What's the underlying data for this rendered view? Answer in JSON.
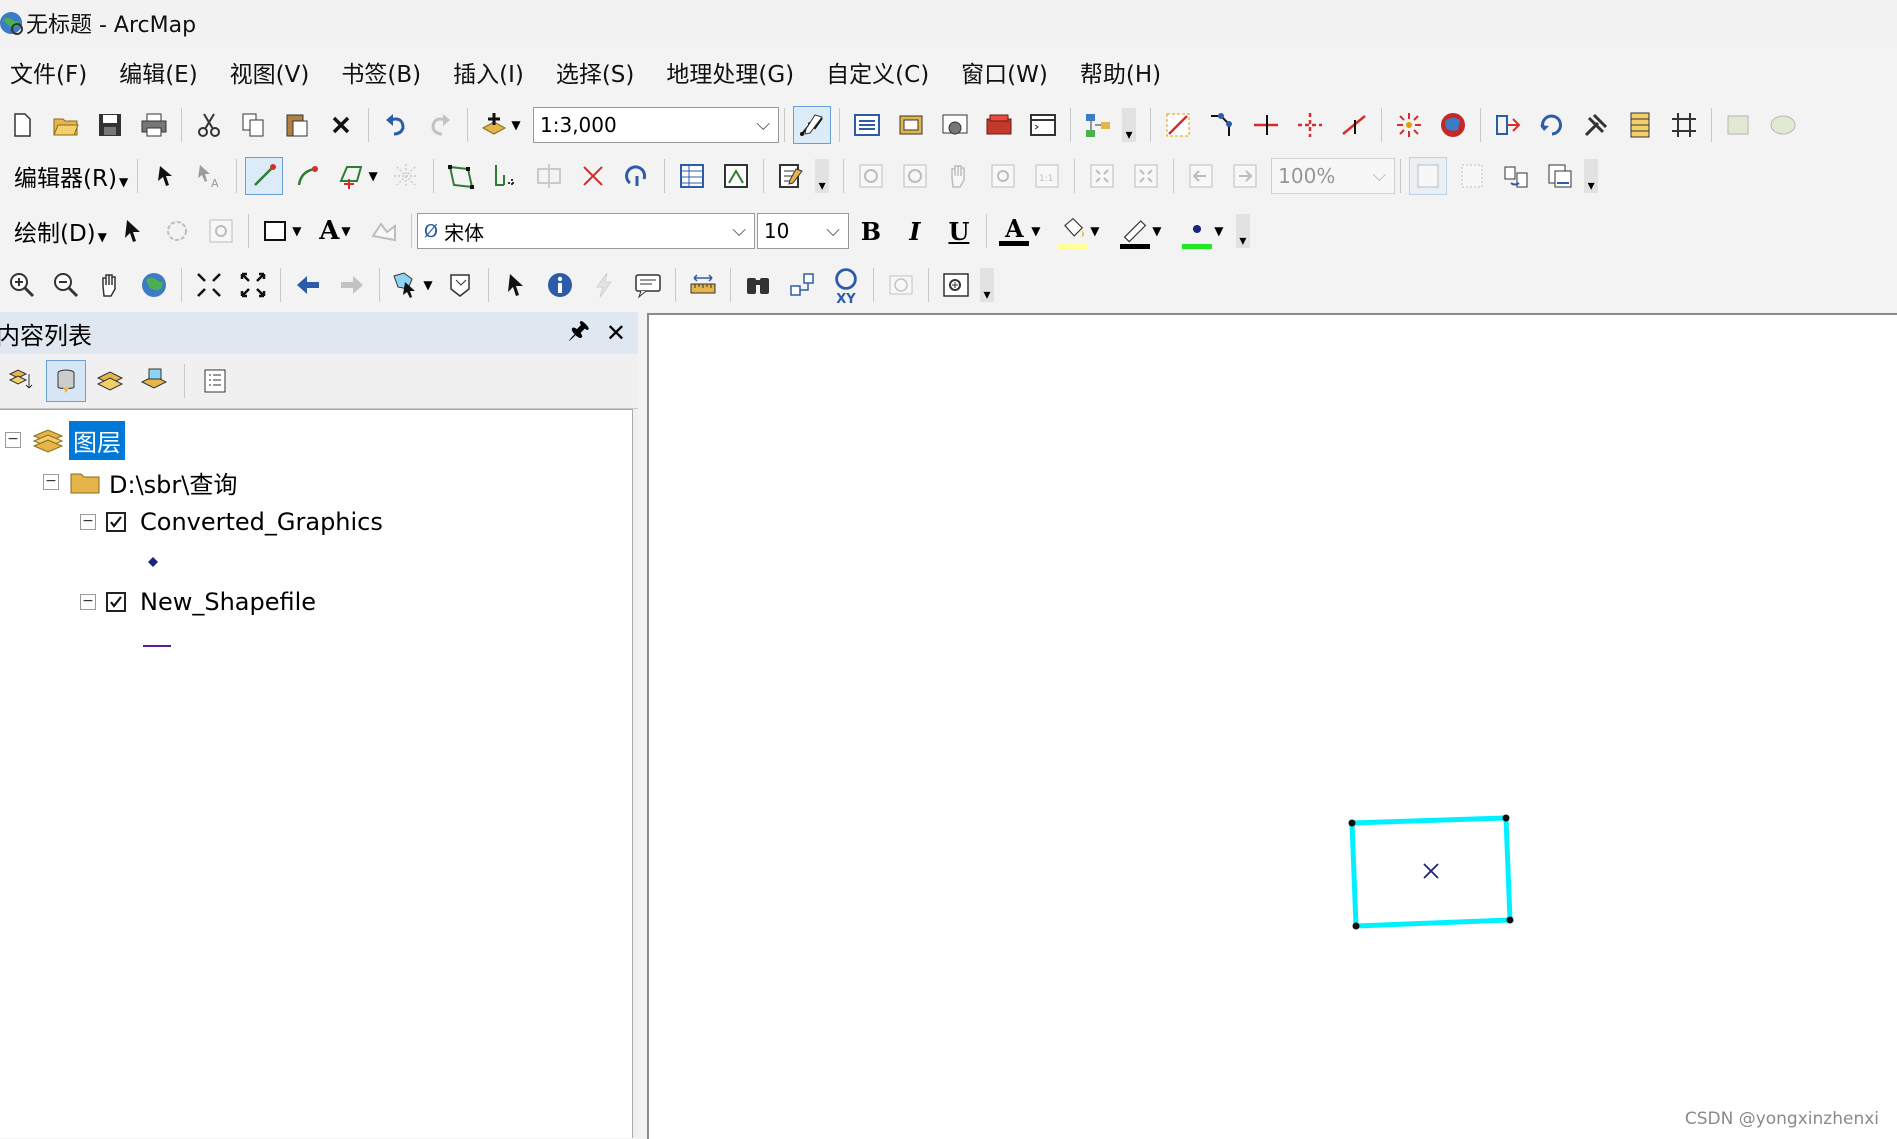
{
  "window": {
    "title": "无标题 - ArcMap"
  },
  "menu": [
    "文件(F)",
    "编辑(E)",
    "视图(V)",
    "书签(B)",
    "插入(I)",
    "选择(S)",
    "地理处理(G)",
    "自定义(C)",
    "窗口(W)",
    "帮助(H)"
  ],
  "standard_toolbar": {
    "scale_value": "1:3,000"
  },
  "editor_toolbar": {
    "label": "编辑器(R)",
    "zoom_value": "100%"
  },
  "draw_toolbar": {
    "label": "绘制(D)",
    "font_name": "宋体",
    "font_size": "10",
    "bold": "B",
    "italic": "I",
    "underline": "U",
    "font_color_letter": "A",
    "text_tool_letter": "A"
  },
  "tools_toolbar": {
    "xy_label": "XY"
  },
  "toc": {
    "title": "内容列表",
    "tree": {
      "root": "图层",
      "folder": "D:\\sbr\\查询",
      "layers": [
        {
          "name": "Converted_Graphics",
          "checked": true,
          "symbol": "point"
        },
        {
          "name": "New_Shapefile",
          "checked": true,
          "symbol": "line"
        }
      ]
    }
  },
  "colors": {
    "selection_cyan": "#00f0ff",
    "highlight_blue": "#0078d7",
    "fill_color_swatch": "#ffff99",
    "line_color_swatch": "#000000",
    "marker_color_swatch": "#22e822"
  },
  "watermark": "CSDN @yongxinzhenxi"
}
